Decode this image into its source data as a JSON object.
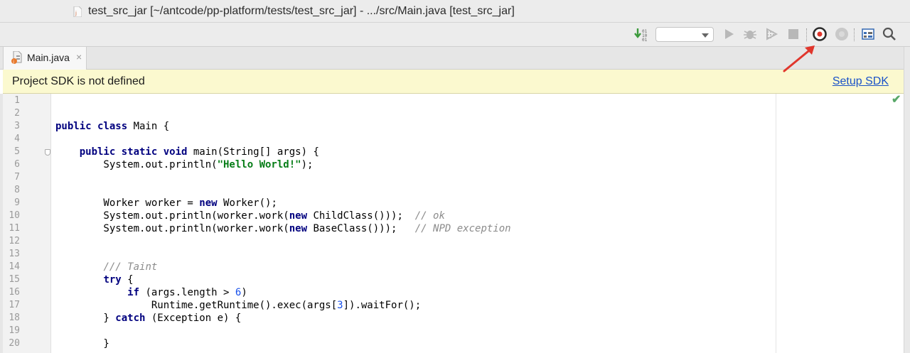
{
  "window": {
    "title": "test_src_jar [~/antcode/pp-platform/tests/test_src_jar] - .../src/Main.java [test_src_jar]"
  },
  "toolbar": {
    "icons": [
      "build-icon",
      "run-config-combo",
      "run-icon",
      "debug-icon",
      "coverage-icon",
      "stop-icon",
      "record-icon",
      "stop-record-icon",
      "project-structure-icon",
      "search-icon"
    ],
    "run_config_value": ""
  },
  "tabs": [
    {
      "label": "Main.java",
      "close": "×",
      "active": true
    }
  ],
  "banner": {
    "message": "Project SDK is not defined",
    "action": "Setup SDK",
    "background": "#fbf9cf"
  },
  "editor": {
    "line_numbers": [
      "1",
      "2",
      "3",
      "4",
      "5",
      "6",
      "7",
      "8",
      "9",
      "10",
      "11",
      "12",
      "13",
      "14",
      "15",
      "16",
      "17",
      "18",
      "19",
      "20"
    ],
    "lines": [
      [],
      [],
      [
        {
          "t": "public class ",
          "c": "kw"
        },
        {
          "t": "Main {",
          "c": ""
        }
      ],
      [],
      [
        {
          "t": "    ",
          "c": ""
        },
        {
          "t": "public static void ",
          "c": "kw"
        },
        {
          "t": "main(String[] args) {",
          "c": ""
        }
      ],
      [
        {
          "t": "        System.out.println(",
          "c": ""
        },
        {
          "t": "\"Hello World!\"",
          "c": "str"
        },
        {
          "t": ");",
          "c": ""
        }
      ],
      [],
      [],
      [
        {
          "t": "        Worker worker = ",
          "c": ""
        },
        {
          "t": "new ",
          "c": "kw"
        },
        {
          "t": "Worker();",
          "c": ""
        }
      ],
      [
        {
          "t": "        System.out.println(worker.work(",
          "c": ""
        },
        {
          "t": "new ",
          "c": "kw"
        },
        {
          "t": "ChildClass()));  ",
          "c": ""
        },
        {
          "t": "// ok",
          "c": "cm"
        }
      ],
      [
        {
          "t": "        System.out.println(worker.work(",
          "c": ""
        },
        {
          "t": "new ",
          "c": "kw"
        },
        {
          "t": "BaseClass()));   ",
          "c": ""
        },
        {
          "t": "// NPD exception",
          "c": "cm"
        }
      ],
      [],
      [],
      [
        {
          "t": "        ",
          "c": ""
        },
        {
          "t": "/// Taint",
          "c": "cm"
        }
      ],
      [
        {
          "t": "        ",
          "c": ""
        },
        {
          "t": "try ",
          "c": "kw"
        },
        {
          "t": "{",
          "c": ""
        }
      ],
      [
        {
          "t": "            ",
          "c": ""
        },
        {
          "t": "if ",
          "c": "kw"
        },
        {
          "t": "(args.length > ",
          "c": ""
        },
        {
          "t": "6",
          "c": "num"
        },
        {
          "t": ")",
          "c": ""
        }
      ],
      [
        {
          "t": "                Runtime.getRuntime().exec(args[",
          "c": ""
        },
        {
          "t": "3",
          "c": "num"
        },
        {
          "t": "]).waitFor();",
          "c": ""
        }
      ],
      [
        {
          "t": "        } ",
          "c": ""
        },
        {
          "t": "catch ",
          "c": "kw"
        },
        {
          "t": "(Exception e) {",
          "c": ""
        }
      ],
      [],
      [
        {
          "t": "        }",
          "c": ""
        }
      ]
    ],
    "inspection_status": "ok-check-icon"
  },
  "colors": {
    "keyword": "#00007f",
    "string": "#067d17",
    "number": "#1750eb",
    "comment": "#8c8c8c",
    "link": "#1a52c8",
    "annotation_arrow": "#e0362c"
  }
}
